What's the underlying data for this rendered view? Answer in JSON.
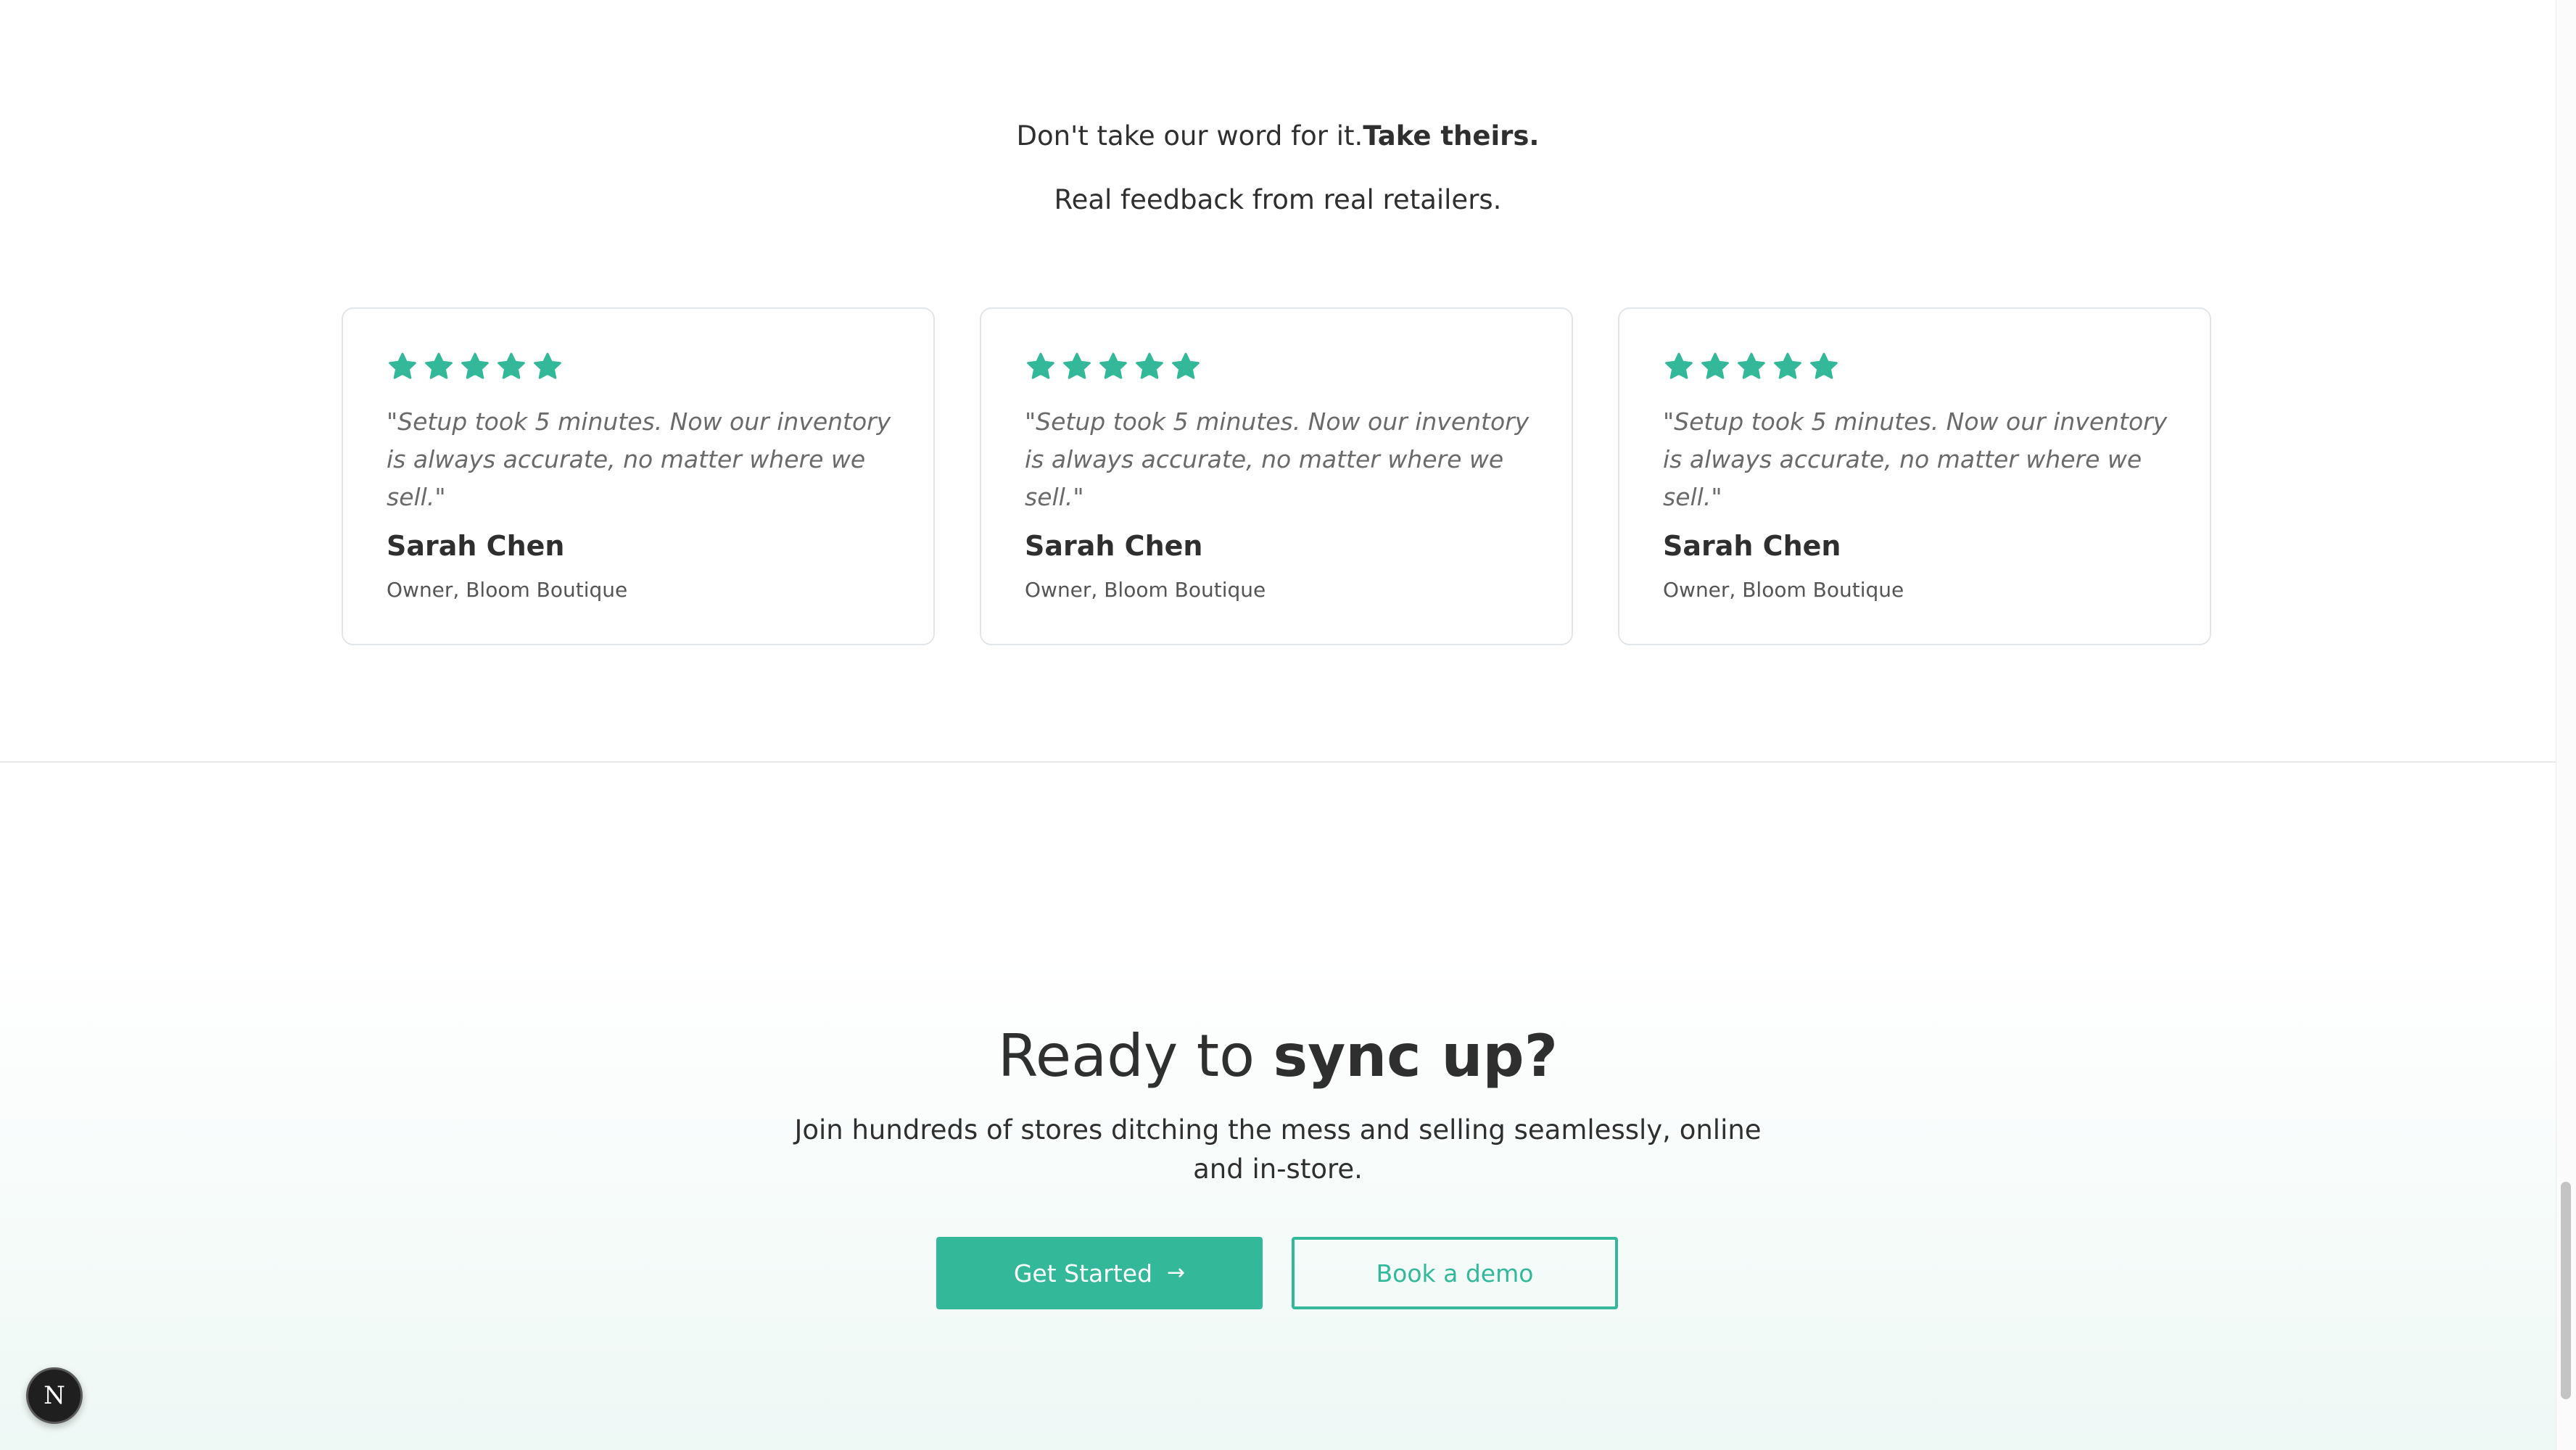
{
  "testimonials": {
    "heading_prefix": "Don't take our word for it.",
    "heading_bold": "Take theirs.",
    "subheading": "Real feedback from real retailers.",
    "star_color": "#33b89a",
    "cards": [
      {
        "rating": 5,
        "quote": "\"Setup took 5 minutes. Now our inventory is always accurate, no matter where we sell.\"",
        "author": "Sarah Chen",
        "role": "Owner, Bloom Boutique"
      },
      {
        "rating": 5,
        "quote": "\"Setup took 5 minutes. Now our inventory is always accurate, no matter where we sell.\"",
        "author": "Sarah Chen",
        "role": "Owner, Bloom Boutique"
      },
      {
        "rating": 5,
        "quote": "\"Setup took 5 minutes. Now our inventory is always accurate, no matter where we sell.\"",
        "author": "Sarah Chen",
        "role": "Owner, Bloom Boutique"
      }
    ]
  },
  "cta": {
    "title_prefix": "Ready to",
    "title_bold": "sync up?",
    "description": "Join hundreds of stores ditching the mess and selling seamlessly, online and in-store.",
    "primary_button": "Get Started",
    "primary_icon": "arrow-right-icon",
    "secondary_button": "Book a demo",
    "accent_color": "#33b89a"
  },
  "dev_badge": {
    "label": "N",
    "icon": "nextjs-logo-icon"
  }
}
